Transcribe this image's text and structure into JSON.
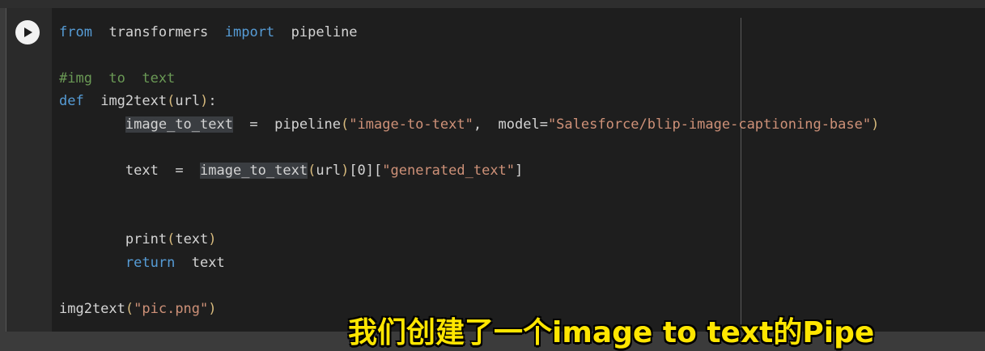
{
  "code": {
    "line1": {
      "kw1": "from",
      "mod": "transformers",
      "kw2": "import",
      "name": "pipeline"
    },
    "line3": {
      "comment": "#img  to  text"
    },
    "line4": {
      "kw": "def",
      "fname": "img2text",
      "open": "(",
      "arg": "url",
      "close": ")",
      "colon": ":"
    },
    "line5": {
      "var": "image_to_text",
      "eq": "  =  ",
      "func": "pipeline",
      "open": "(",
      "str1": "\"image-to-text\"",
      "sep": ",  model=",
      "str2": "\"Salesforce/blip-image-captioning-base\"",
      "close": ")"
    },
    "line7": {
      "var": "text",
      "eq": "  =  ",
      "call": "image_to_text",
      "open": "(",
      "arg": "url",
      "close": ")",
      "idx": "[0][",
      "key": "\"generated_text\"",
      "end": "]"
    },
    "line10": {
      "func": "print",
      "open": "(",
      "arg": "text",
      "close": ")"
    },
    "line11": {
      "kw": "return",
      "val": "  text"
    },
    "line13": {
      "func": "img2text",
      "open": "(",
      "str": "\"pic.png\"",
      "close": ")"
    }
  },
  "subtitle": "我们创建了一个image to text的Pipe",
  "colors": {
    "keyword": "#569cd6",
    "comment": "#6a9955",
    "string": "#ce9178",
    "subtitle": "#ffe600"
  }
}
